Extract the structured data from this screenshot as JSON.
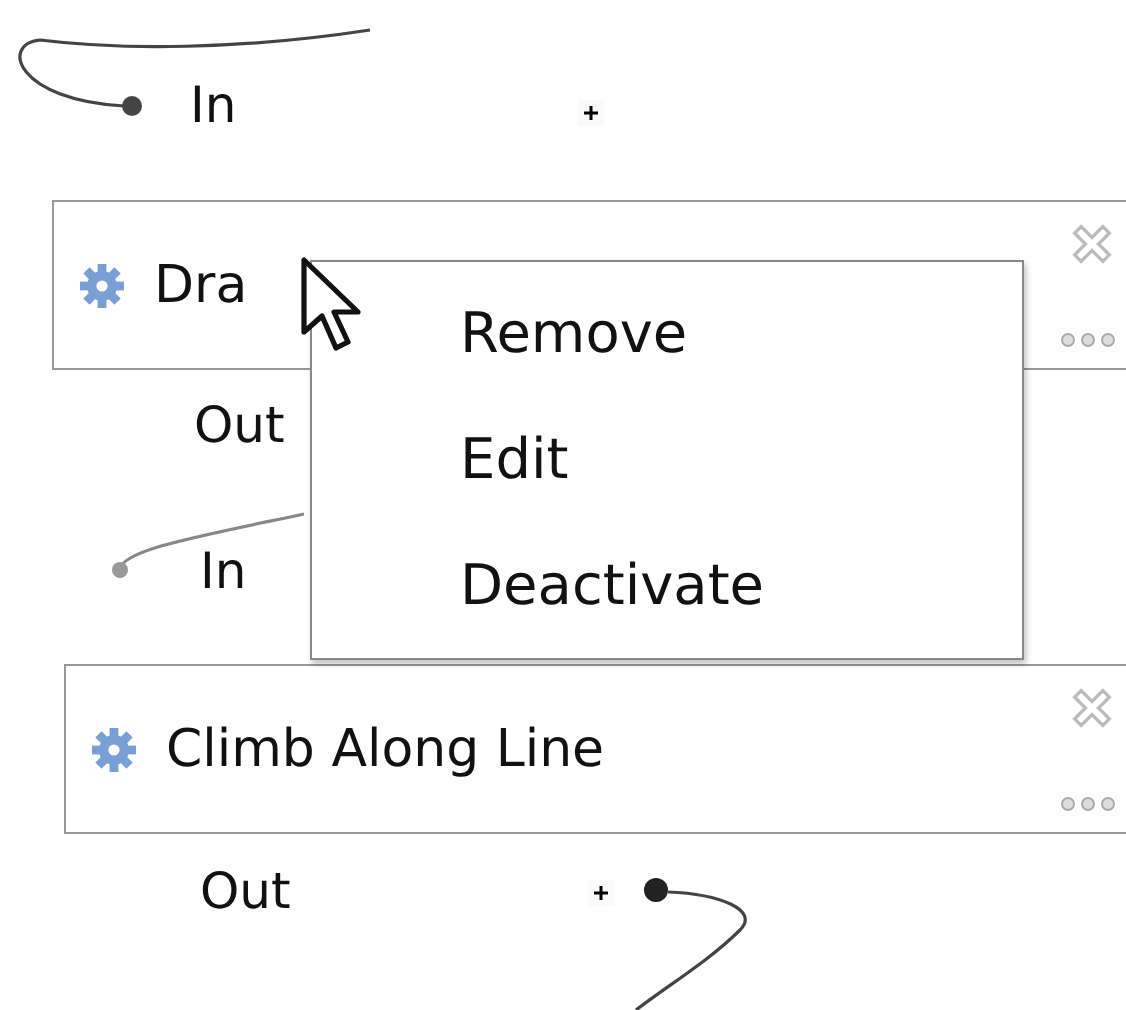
{
  "nodes": [
    {
      "title": "Dra",
      "input": "In",
      "output": "Out"
    },
    {
      "title": "Climb Along Line",
      "input": "In",
      "output": "Out"
    }
  ],
  "context_menu": {
    "items": [
      "Remove",
      "Edit",
      "Deactivate"
    ]
  }
}
